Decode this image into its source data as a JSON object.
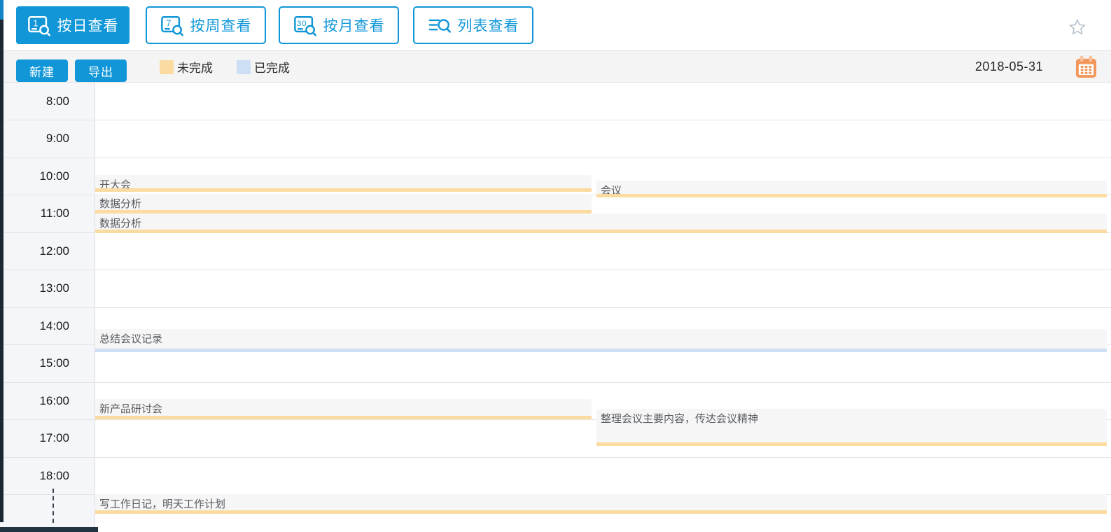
{
  "toolbar": {
    "view_buttons": [
      {
        "label": "按日查看",
        "badge": "1",
        "icon": "calendar-day-search-icon",
        "active": true
      },
      {
        "label": "按周查看",
        "badge": "7",
        "icon": "calendar-week-search-icon",
        "active": false
      },
      {
        "label": "按月查看",
        "badge": "30",
        "icon": "calendar-month-search-icon",
        "active": false
      },
      {
        "label": "列表查看",
        "badge": "",
        "icon": "list-search-icon",
        "active": false
      }
    ],
    "accent_color": "#1197d8"
  },
  "actionbar": {
    "new_label": "新建",
    "export_label": "导出",
    "legend": [
      {
        "label": "未完成",
        "color": "#fbdba0"
      },
      {
        "label": "已完成",
        "color": "#cddff5"
      }
    ],
    "date": "2018-05-31",
    "calendar_icon_color": "#f2965a"
  },
  "grid": {
    "times": [
      "8:00",
      "9:00",
      "10:00",
      "11:00",
      "12:00",
      "13:00",
      "14:00",
      "15:00",
      "16:00",
      "17:00",
      "18:00"
    ],
    "row_height": 53.5,
    "colors": {
      "pending": "#fbdba0",
      "done": "#cddff5",
      "event_bg": "#f6f6f6"
    },
    "events": [
      {
        "title": "开大会",
        "status": "未完成",
        "color": "#fbdba0"
      },
      {
        "title": "会议",
        "status": "未完成",
        "color": "#fbdba0"
      },
      {
        "title": "数据分析",
        "status": "未完成",
        "color": "#fbdba0"
      },
      {
        "title": "数据分析",
        "status": "未完成",
        "color": "#fbdba0"
      },
      {
        "title": "总结会议记录",
        "status": "已完成",
        "color": "#cddff5"
      },
      {
        "title": "新产品研讨会",
        "status": "未完成",
        "color": "#fbdba0"
      },
      {
        "title": "整理会议主要内容，传达会议精神",
        "status": "未完成",
        "color": "#fbdba0"
      },
      {
        "title": "写工作日记，明天工作计划",
        "status": "未完成",
        "color": "#fbdba0"
      }
    ]
  }
}
